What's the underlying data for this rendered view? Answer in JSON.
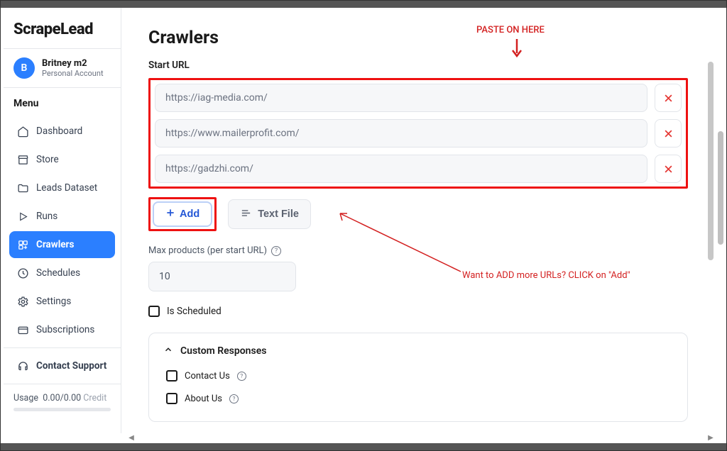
{
  "brand": "ScrapeLead",
  "account": {
    "avatar_letter": "B",
    "name": "Britney m2",
    "sub": "Personal Account"
  },
  "menu_header": "Menu",
  "nav": [
    {
      "id": "dashboard",
      "label": "Dashboard"
    },
    {
      "id": "store",
      "label": "Store"
    },
    {
      "id": "leads",
      "label": "Leads Dataset"
    },
    {
      "id": "runs",
      "label": "Runs"
    },
    {
      "id": "crawlers",
      "label": "Crawlers"
    },
    {
      "id": "schedules",
      "label": "Schedules"
    },
    {
      "id": "settings",
      "label": "Settings"
    },
    {
      "id": "subs",
      "label": "Subscriptions"
    },
    {
      "id": "support",
      "label": "Contact Support"
    }
  ],
  "usage": {
    "label": "Usage",
    "value": "0.00/0.00",
    "suffix": "Credit"
  },
  "page": {
    "title": "Crawlers",
    "start_url_label": "Start URL"
  },
  "urls": [
    "https://iag-media.com/",
    "https://www.mailerprofit.com/",
    "https://gadzhi.com/"
  ],
  "buttons": {
    "add": "Add",
    "text_file": "Text File"
  },
  "max": {
    "label": "Max products (per start URL)",
    "value": "10"
  },
  "scheduled": {
    "label": "Is Scheduled"
  },
  "panel": {
    "title": "Custom Responses",
    "items": [
      "Contact Us",
      "About Us"
    ]
  },
  "annotations": {
    "paste": "PASTE ON HERE",
    "add_more": "Want to ADD more URLs? CLICK on \"Add\""
  }
}
